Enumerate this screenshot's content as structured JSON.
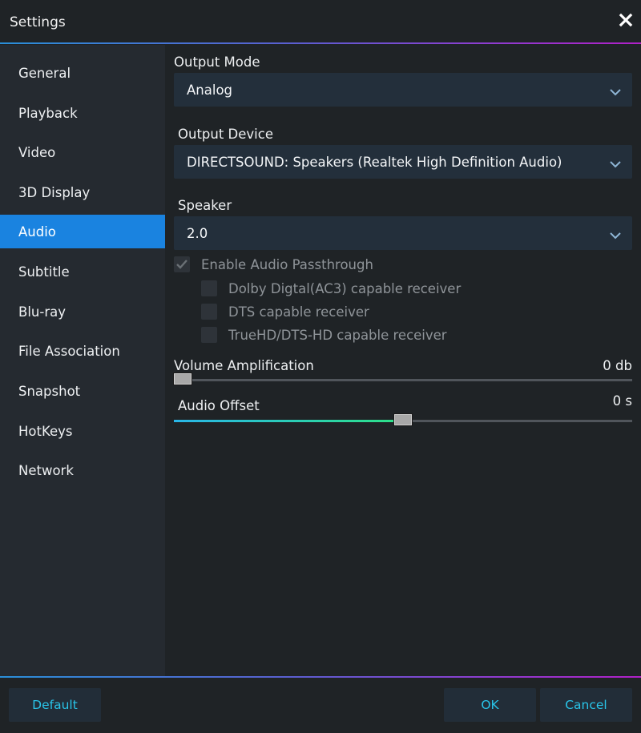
{
  "window": {
    "title": "Settings",
    "close_icon": "close-icon"
  },
  "sidebar": {
    "items": [
      {
        "label": "General",
        "active": false
      },
      {
        "label": "Playback",
        "active": false
      },
      {
        "label": "Video",
        "active": false
      },
      {
        "label": "3D Display",
        "active": false
      },
      {
        "label": "Audio",
        "active": true
      },
      {
        "label": "Subtitle",
        "active": false
      },
      {
        "label": "Blu-ray",
        "active": false
      },
      {
        "label": "File Association",
        "active": false
      },
      {
        "label": "Snapshot",
        "active": false
      },
      {
        "label": "HotKeys",
        "active": false
      },
      {
        "label": "Network",
        "active": false
      }
    ]
  },
  "audio": {
    "output_mode": {
      "label": "Output Mode",
      "value": "Analog"
    },
    "output_device": {
      "label": "Output Device",
      "value": "DIRECTSOUND: Speakers (Realtek High Definition Audio)"
    },
    "speaker": {
      "label": "Speaker",
      "value": "2.0"
    },
    "passthrough": {
      "label": "Enable Audio Passthrough",
      "checked": true,
      "disabled": true,
      "options": [
        {
          "label": "Dolby Digtal(AC3) capable receiver",
          "checked": false
        },
        {
          "label": "DTS capable receiver",
          "checked": false
        },
        {
          "label": "TrueHD/DTS-HD capable receiver",
          "checked": false
        }
      ]
    },
    "volume_amplification": {
      "label": "Volume Amplification",
      "value_text": "0 db",
      "position": 0.0
    },
    "audio_offset": {
      "label": "Audio Offset",
      "value_text": "0 s",
      "position": 0.5
    }
  },
  "footer": {
    "default_label": "Default",
    "ok_label": "OK",
    "cancel_label": "Cancel"
  },
  "colors": {
    "accent": "#1a83e0",
    "button_text": "#29c4e8",
    "background": "#1f2326",
    "sidebar": "#252a30"
  }
}
